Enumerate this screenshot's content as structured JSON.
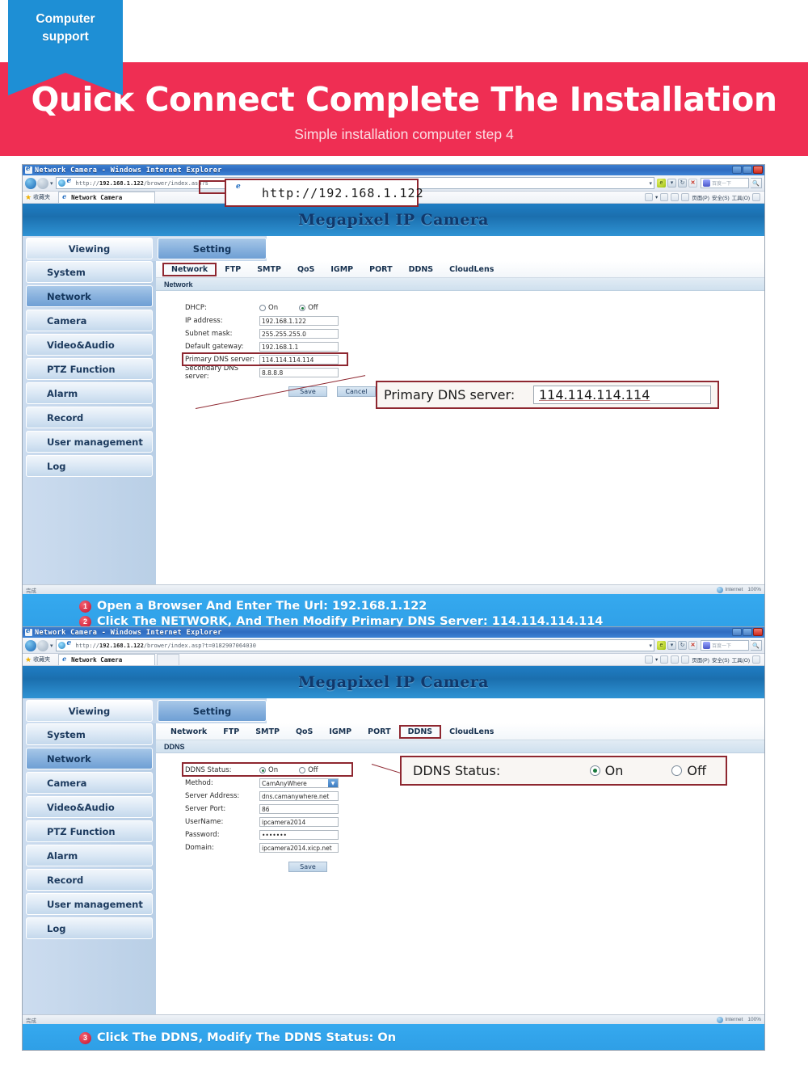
{
  "banner": {
    "ribbon_line1": "Computer",
    "ribbon_line2": "support",
    "title": "Quick Connect Complete The Installation",
    "subtitle": "Simple installation computer step 4",
    "bg_color": "#ef2e53",
    "ribbon_color": "#1e8fd5"
  },
  "window1": {
    "title": "Network Camera - Windows Internet Explorer",
    "url_prefix": "http://",
    "url_host": "192.168.1.122",
    "url_suffix": "/brower/index.asp?s",
    "favorites_label": "收藏夹",
    "tab_label": "Network Camera",
    "search_placeholder": "百度一下",
    "command_menus": [
      "页面(P)",
      "安全(S)",
      "工具(O)"
    ],
    "cam_title": "Megapixel IP Camera",
    "top_tabs": [
      {
        "label": "Viewing",
        "active": false
      },
      {
        "label": "Setting",
        "active": true
      }
    ],
    "sidebar": [
      {
        "label": "System",
        "active": false
      },
      {
        "label": "Network",
        "active": true
      },
      {
        "label": "Camera",
        "active": false
      },
      {
        "label": "Video&Audio",
        "active": false
      },
      {
        "label": "PTZ Function",
        "active": false
      },
      {
        "label": "Alarm",
        "active": false
      },
      {
        "label": "Record",
        "active": false
      },
      {
        "label": "User management",
        "active": false
      },
      {
        "label": "Log",
        "active": false
      }
    ],
    "content_tabs": [
      {
        "label": "Network",
        "selected": true
      },
      {
        "label": "FTP",
        "selected": false
      },
      {
        "label": "SMTP",
        "selected": false
      },
      {
        "label": "QoS",
        "selected": false
      },
      {
        "label": "IGMP",
        "selected": false
      },
      {
        "label": "PORT",
        "selected": false
      },
      {
        "label": "DDNS",
        "selected": false
      },
      {
        "label": "CloudLens",
        "selected": false
      }
    ],
    "section_title": "Network",
    "form": {
      "dhcp_label": "DHCP:",
      "dhcp_on": "On",
      "dhcp_off": "Off",
      "dhcp_value": "Off",
      "ip_label": "IP address:",
      "ip_value": "192.168.1.122",
      "subnet_label": "Subnet mask:",
      "subnet_value": "255.255.255.0",
      "gateway_label": "Default gateway:",
      "gateway_value": "192.168.1.1",
      "dns1_label": "Primary DNS server:",
      "dns1_value": "114.114.114.114",
      "dns2_label": "Secondary DNS server:",
      "dns2_value": "8.8.8.8",
      "save_label": "Save",
      "cancel_label": "Cancel"
    },
    "callout_url": "http://192.168.1.122",
    "callout_dns_label": "Primary DNS server:",
    "callout_dns_value": "114.114.114.114",
    "status_left": "完成",
    "status_zone": "Internet",
    "status_zoom": "100%"
  },
  "instructions_1": [
    {
      "num": "1",
      "text": "Open a Browser And Enter The Url: 192.168.1.122"
    },
    {
      "num": "2",
      "text": "Click The NETWORK, And Then Modify Primary DNS Server: 114.114.114.114"
    }
  ],
  "window2": {
    "title": "Network Camera - Windows Internet Explorer",
    "url_prefix": "http://",
    "url_host": "192.168.1.122",
    "url_suffix": "/brower/index.asp?t=0182907064030",
    "favorites_label": "收藏夹",
    "tab_label": "Network Camera",
    "search_placeholder": "百度一下",
    "command_menus": [
      "页面(P)",
      "安全(S)",
      "工具(O)"
    ],
    "cam_title": "Megapixel IP Camera",
    "top_tabs": [
      {
        "label": "Viewing",
        "active": false
      },
      {
        "label": "Setting",
        "active": true
      }
    ],
    "sidebar": [
      {
        "label": "System",
        "active": false
      },
      {
        "label": "Network",
        "active": true
      },
      {
        "label": "Camera",
        "active": false
      },
      {
        "label": "Video&Audio",
        "active": false
      },
      {
        "label": "PTZ Function",
        "active": false
      },
      {
        "label": "Alarm",
        "active": false
      },
      {
        "label": "Record",
        "active": false
      },
      {
        "label": "User management",
        "active": false
      },
      {
        "label": "Log",
        "active": false
      }
    ],
    "content_tabs": [
      {
        "label": "Network",
        "selected": false
      },
      {
        "label": "FTP",
        "selected": false
      },
      {
        "label": "SMTP",
        "selected": false
      },
      {
        "label": "QoS",
        "selected": false
      },
      {
        "label": "IGMP",
        "selected": false
      },
      {
        "label": "PORT",
        "selected": false
      },
      {
        "label": "DDNS",
        "selected": true
      },
      {
        "label": "CloudLens",
        "selected": false
      }
    ],
    "section_title": "DDNS",
    "form": {
      "status_label": "DDNS Status:",
      "status_on": "On",
      "status_off": "Off",
      "status_value": "On",
      "method_label": "Method:",
      "method_value": "CamAnyWhere",
      "server_addr_label": "Server Address:",
      "server_addr_value": "dns.camanywhere.net",
      "server_port_label": "Server Port:",
      "server_port_value": "86",
      "username_label": "UserName:",
      "username_value": "ipcamera2014",
      "password_label": "Password:",
      "password_value": "•••••••",
      "domain_label": "Domain:",
      "domain_value": "ipcamera2014.xicp.net",
      "save_label": "Save"
    },
    "callout_label": "DDNS Status:",
    "callout_on": "On",
    "callout_off": "Off",
    "status_left": "完成",
    "status_zone": "Internet",
    "status_zoom": "100%"
  },
  "instructions_2": [
    {
      "num": "3",
      "text": "Click The DDNS, Modify The DDNS Status: On"
    }
  ]
}
